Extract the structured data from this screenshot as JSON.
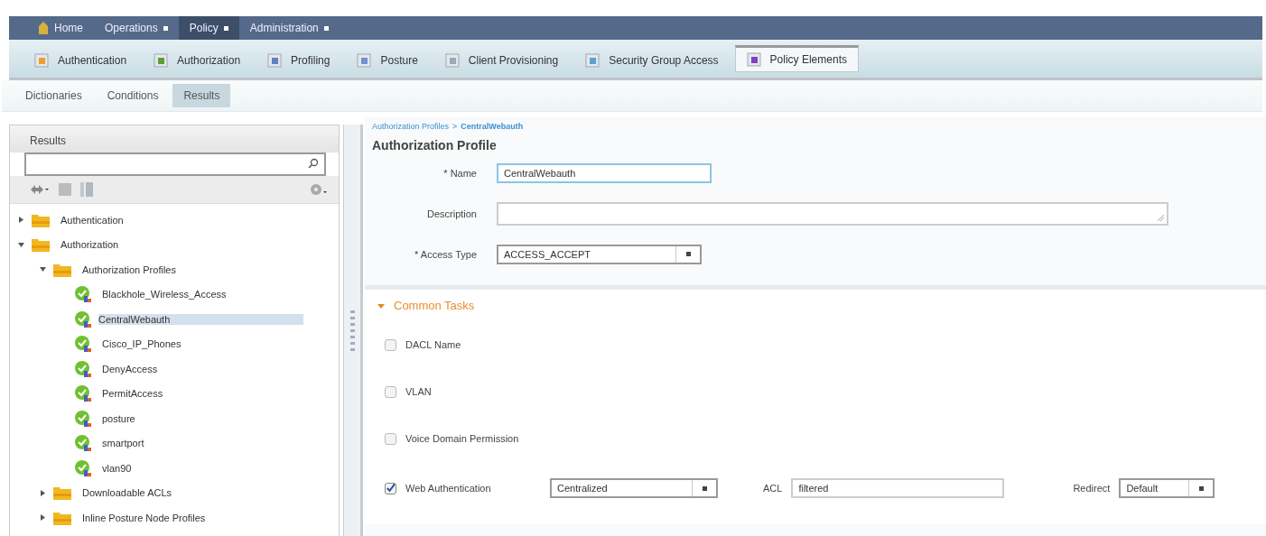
{
  "top_menu": [
    {
      "label": "Home",
      "dropdown": false,
      "selected": false
    },
    {
      "label": "Operations",
      "dropdown": true,
      "selected": false
    },
    {
      "label": "Policy",
      "dropdown": true,
      "selected": true
    },
    {
      "label": "Administration",
      "dropdown": true,
      "selected": false
    }
  ],
  "tabs": [
    {
      "label": "Authentication",
      "selected": false
    },
    {
      "label": "Authorization",
      "selected": false
    },
    {
      "label": "Profiling",
      "selected": false
    },
    {
      "label": "Posture",
      "selected": false
    },
    {
      "label": "Client Provisioning",
      "selected": false
    },
    {
      "label": "Security Group Access",
      "selected": false
    },
    {
      "label": "Policy Elements",
      "selected": true
    }
  ],
  "subtabs": [
    {
      "label": "Dictionaries",
      "selected": false
    },
    {
      "label": "Conditions",
      "selected": false
    },
    {
      "label": "Results",
      "selected": true
    }
  ],
  "results_panel": {
    "title": "Results",
    "tree": [
      {
        "label": "Authentication",
        "kind": "folder",
        "expanded": false,
        "selected": false
      },
      {
        "label": "Authorization",
        "kind": "folder",
        "expanded": true,
        "selected": false,
        "children": [
          {
            "label": "Authorization Profiles",
            "kind": "folder",
            "expanded": true,
            "selected": false,
            "children": [
              {
                "label": "Blackhole_Wireless_Access",
                "kind": "profile",
                "selected": false
              },
              {
                "label": "CentralWebauth",
                "kind": "profile",
                "selected": true
              },
              {
                "label": "Cisco_IP_Phones",
                "kind": "profile",
                "selected": false
              },
              {
                "label": "DenyAccess",
                "kind": "profile",
                "selected": false
              },
              {
                "label": "PermitAccess",
                "kind": "profile",
                "selected": false
              },
              {
                "label": "posture",
                "kind": "profile",
                "selected": false
              },
              {
                "label": "smartport",
                "kind": "profile",
                "selected": false
              },
              {
                "label": "vlan90",
                "kind": "profile",
                "selected": false
              }
            ]
          },
          {
            "label": "Downloadable ACLs",
            "kind": "folder",
            "expanded": false,
            "selected": false
          },
          {
            "label": "Inline Posture Node Profiles",
            "kind": "folder",
            "expanded": false,
            "selected": false
          }
        ]
      }
    ]
  },
  "form": {
    "breadcrumb": [
      {
        "label": "Authorization Profiles"
      },
      {
        "label": "CentralWebauth"
      }
    ],
    "breadcrumb_separator": ">",
    "heading": "Authorization Profile",
    "fields": [
      {
        "label": "* Name",
        "kind": "text",
        "value": "CentralWebauth",
        "focused": true
      },
      {
        "label": "Description",
        "kind": "textarea",
        "focused": false
      },
      {
        "label": "* Access Type",
        "kind": "select",
        "value": "ACCESS_ACCEPT",
        "focused": false
      }
    ]
  },
  "common_tasks": {
    "title": "Common Tasks",
    "expanded": true,
    "items": [
      {
        "label": "DACL Name",
        "checked": false,
        "kind": "checkbox"
      },
      {
        "label": "VLAN",
        "checked": false,
        "kind": "checkbox"
      },
      {
        "label": "Voice Domain Permission",
        "checked": false,
        "kind": "checkbox"
      },
      {
        "label": "Web Authentication",
        "checked": true,
        "kind": "web_auth",
        "type_value": "Centralized",
        "acl_label": "ACL",
        "acl_value": "filtered",
        "redirect_label": "Redirect",
        "redirect_value": "Default"
      }
    ]
  }
}
